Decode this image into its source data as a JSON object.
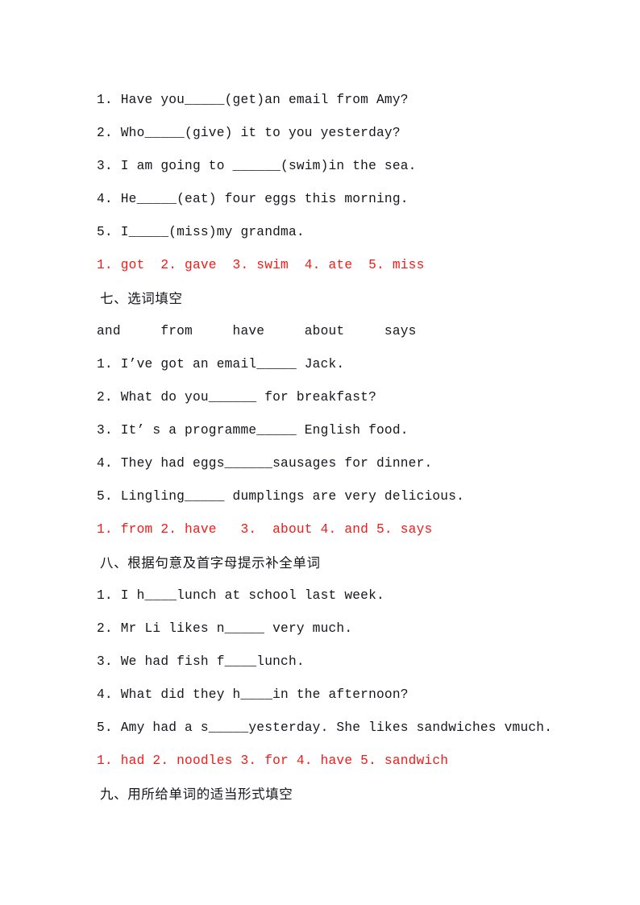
{
  "document": {
    "page_background": "#ffffff",
    "text_color": "#16161c",
    "answer_color": "#ee1c18",
    "blocks": [
      {
        "kind": "exercise",
        "text": "1. Have you_____(get)an email from Amy?"
      },
      {
        "kind": "exercise",
        "text": "2. Who_____(give) it to you yesterday?"
      },
      {
        "kind": "exercise",
        "text": "3. I am going to ______(swim)in the sea."
      },
      {
        "kind": "exercise",
        "text": "4. He_____(eat) four eggs this morning."
      },
      {
        "kind": "exercise",
        "text": "5. I_____(miss)my grandma."
      },
      {
        "kind": "answer",
        "text": "1. got  2. gave  3. swim  4. ate  5. miss"
      },
      {
        "kind": "heading",
        "text": "七、选词填空"
      },
      {
        "kind": "wordbank",
        "text": "and     from     have     about     says"
      },
      {
        "kind": "exercise",
        "text": "1. I’ve got an email_____ Jack."
      },
      {
        "kind": "exercise",
        "text": "2. What do you______ for breakfast?"
      },
      {
        "kind": "exercise",
        "text": "3. It’ s a programme_____ English food."
      },
      {
        "kind": "exercise",
        "text": "4. They had eggs______sausages for dinner."
      },
      {
        "kind": "exercise",
        "text": "5. Lingling_____ dumplings are very delicious."
      },
      {
        "kind": "answer",
        "text": "1. from 2. have   3.  about 4. and 5. says"
      },
      {
        "kind": "heading",
        "text": "八、根据句意及首字母提示补全单词"
      },
      {
        "kind": "exercise",
        "text": "1. I h____lunch at school last week."
      },
      {
        "kind": "exercise",
        "text": "2. Mr Li likes n_____ very much."
      },
      {
        "kind": "exercise",
        "text": "3. We had fish f____lunch."
      },
      {
        "kind": "exercise",
        "text": "4. What did they h____in the afternoon?"
      },
      {
        "kind": "exercise",
        "text": "5. Amy had a s_____yesterday. She likes sandwiches vmuch."
      },
      {
        "kind": "answer",
        "text": "1. had 2. noodles 3. for 4. have 5. sandwich"
      },
      {
        "kind": "heading",
        "text": "九、用所给单词的适当形式填空"
      }
    ]
  }
}
